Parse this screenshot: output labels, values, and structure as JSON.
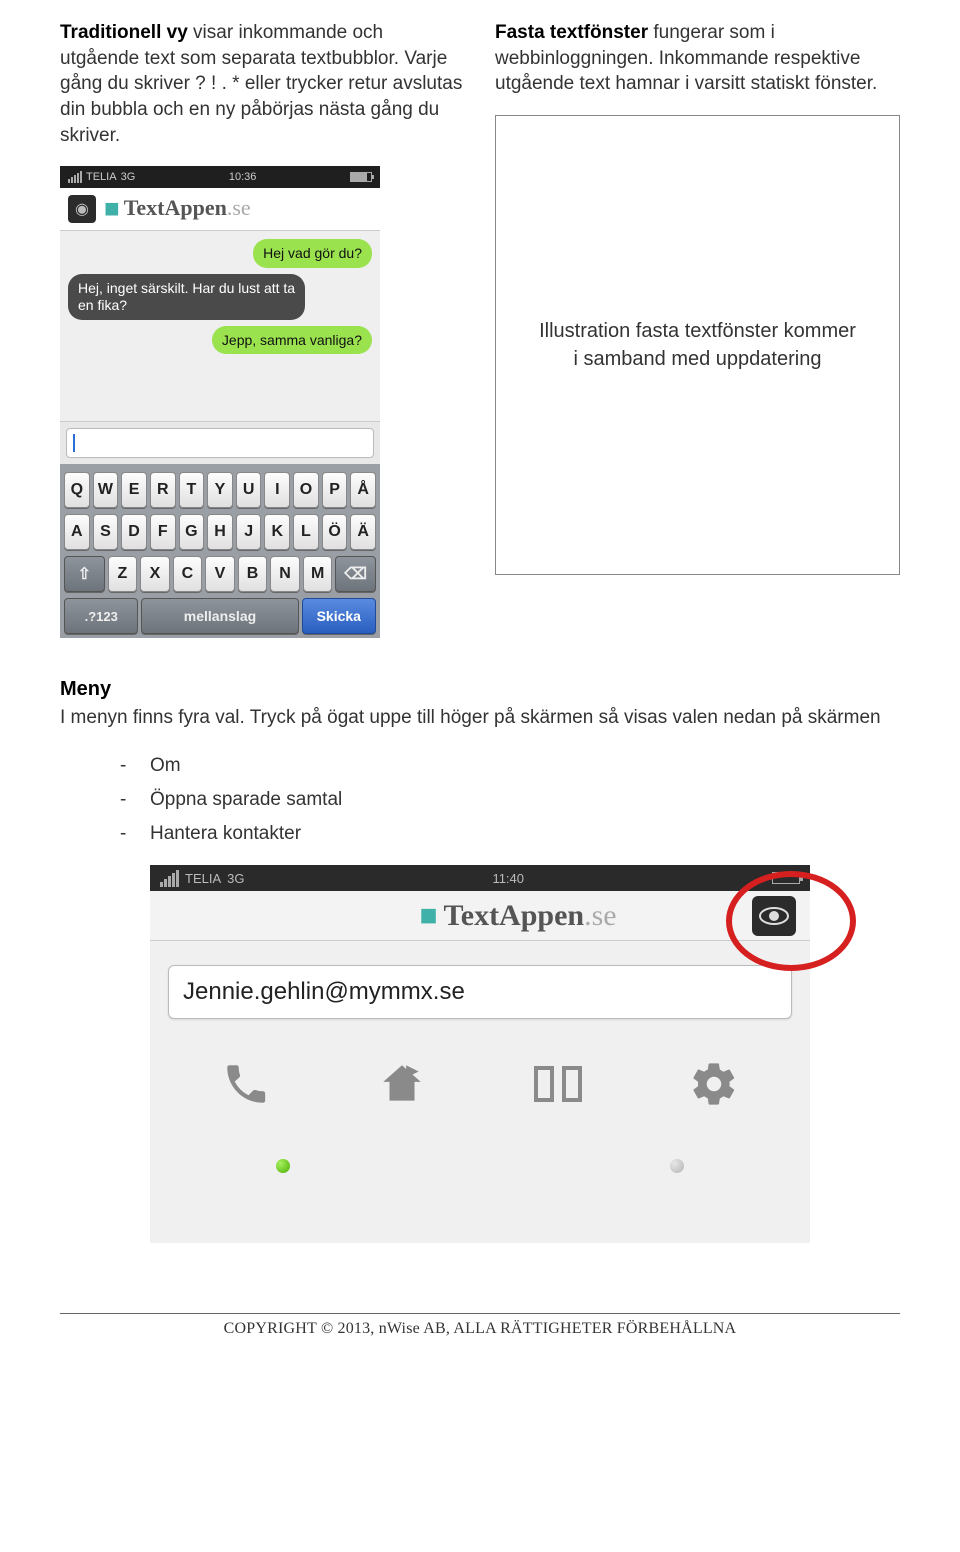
{
  "intro_left_bold": "Traditionell vy",
  "intro_left_rest": " visar inkommande och utgående text som separata textbubblor. Varje gång du skriver ? ! . * eller trycker retur avslutas din bubbla och en ny påbörjas nästa gång du skriver.",
  "intro_right_bold": "Fasta textfönster",
  "intro_right_rest": " fungerar som i webbinloggningen. Inkommande respektive utgående text hamnar i varsitt statiskt fönster.",
  "phone1": {
    "carrier": "TELIA",
    "network": "3G",
    "time": "10:36",
    "brand_main": "TextAppen",
    "brand_suffix": ".se",
    "msgs": [
      {
        "side": "right",
        "text": "Hej vad gör du?"
      },
      {
        "side": "left",
        "text": "Hej, inget särskilt. Har du lust att ta en fika?"
      },
      {
        "side": "right",
        "text": "Jepp, samma vanliga?"
      }
    ],
    "keys_row1": [
      "Q",
      "W",
      "E",
      "R",
      "T",
      "Y",
      "U",
      "I",
      "O",
      "P",
      "Å"
    ],
    "keys_row2": [
      "A",
      "S",
      "D",
      "F",
      "G",
      "H",
      "J",
      "K",
      "L",
      "Ö",
      "Ä"
    ],
    "keys_row3": [
      "Z",
      "X",
      "C",
      "V",
      "B",
      "N",
      "M"
    ],
    "key_123": ".?123",
    "key_space": "mellanslag",
    "key_send": "Skicka"
  },
  "fixedbox_text": "Illustration fasta textfönster kommer i samband med uppdatering",
  "meny_heading": "Meny",
  "meny_text": "I menyn finns fyra val. Tryck på ögat uppe till höger på skärmen så visas valen nedan på skärmen",
  "meny_items": [
    "Om",
    "Öppna sparade samtal",
    "Hantera kontakter"
  ],
  "phone2": {
    "carrier": "TELIA",
    "network": "3G",
    "time": "11:40",
    "brand_main": "TextAppen",
    "brand_suffix": ".se",
    "address": "Jennie.gehlin@mymmx.se"
  },
  "footer": "COPYRIGHT © 2013,  nWise AB,  ALLA RÄTTIGHETER FÖRBEHÅLLNA"
}
